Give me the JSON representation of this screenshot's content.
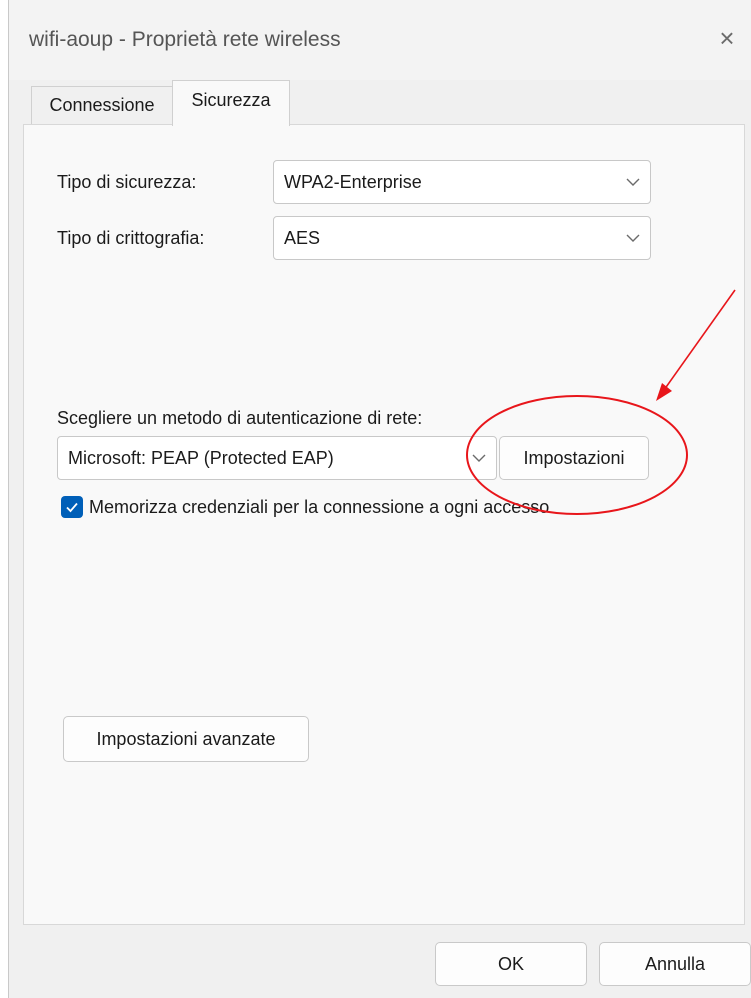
{
  "window": {
    "title": "wifi-aoup - Proprietà rete wireless",
    "close_label": "×"
  },
  "tabs": [
    {
      "label": "Connessione",
      "active": false
    },
    {
      "label": "Sicurezza",
      "active": true
    }
  ],
  "security": {
    "type_label": "Tipo di sicurezza:",
    "type_value": "WPA2-Enterprise",
    "encryption_label": "Tipo di crittografia:",
    "encryption_value": "AES"
  },
  "auth": {
    "method_label": "Scegliere un metodo di autenticazione di rete:",
    "method_value": "Microsoft: PEAP (Protected EAP)",
    "settings_button": "Impostazioni",
    "remember_checked": true,
    "remember_label": "Memorizza credenziali per la connessione a ogni accesso"
  },
  "advanced_button": "Impostazioni avanzate",
  "footer": {
    "ok_label": "OK",
    "cancel_label": "Annulla"
  },
  "annotation_color": "#e8161b",
  "icons": [
    "close-icon",
    "chevron-down-icon",
    "checkmark-icon"
  ]
}
